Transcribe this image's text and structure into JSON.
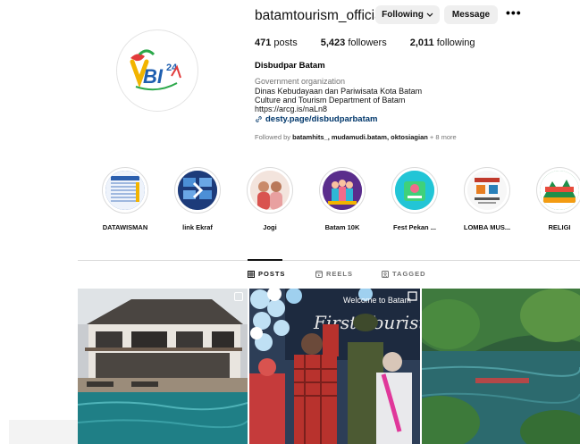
{
  "profile": {
    "username": "batamtourism_official",
    "following_label": "Following",
    "message_label": "Message",
    "stats": {
      "posts": "471",
      "posts_label": "posts",
      "followers": "5,423",
      "followers_label": "followers",
      "following": "2,011",
      "following_label": "following"
    },
    "name": "Disbudpar Batam",
    "category": "Government organization",
    "bio": [
      "Dinas Kebudayaan dan Pariwisata Kota Batam",
      "Culture and Tourism Department of Batam",
      "https://arcg.is/naLn8"
    ],
    "link": "desty.page/disbudparbatam",
    "followed_by_prefix": "Followed by",
    "followed_by_names": "batamhits_, mudamudi.batam, oktosiagian",
    "followed_by_suffix": "+ 8 more",
    "avatar_logo_text": "BI",
    "avatar_logo_number": "24"
  },
  "highlights": [
    {
      "label": "DATAWISMAN"
    },
    {
      "label": "link Ekraf"
    },
    {
      "label": "Jogi"
    },
    {
      "label": "Batam 10K"
    },
    {
      "label": "Fest Pekan ..."
    },
    {
      "label": "LOMBA MUS..."
    },
    {
      "label": "RELIGI"
    }
  ],
  "tabs": {
    "posts": "POSTS",
    "reels": "REELS",
    "tagged": "TAGGED"
  },
  "posts": {
    "post2_banner": "Welcome to Batam",
    "post2_title": "First Tourist"
  },
  "colors": {
    "link": "#00376b",
    "muted": "#737373",
    "button_bg": "#efefef"
  }
}
